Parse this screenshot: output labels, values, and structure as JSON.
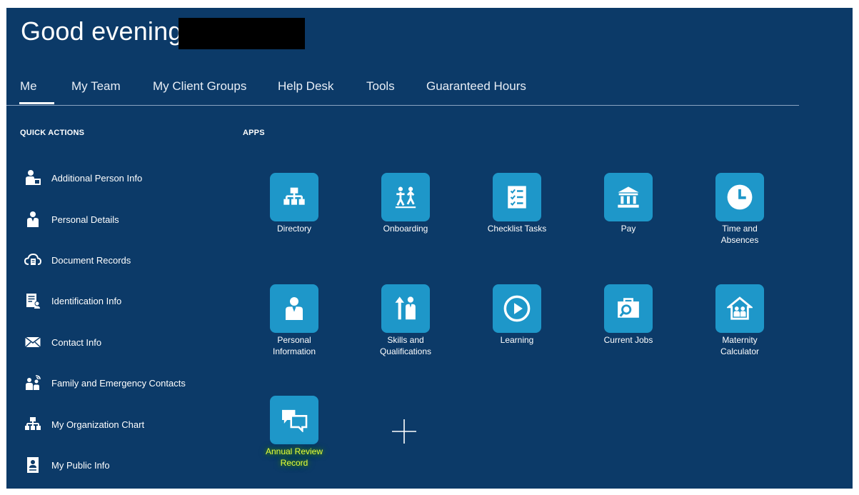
{
  "greeting": "Good evening,",
  "nav": {
    "tabs": [
      {
        "label": "Me"
      },
      {
        "label": "My Team"
      },
      {
        "label": "My Client Groups"
      },
      {
        "label": "Help Desk"
      },
      {
        "label": "Tools"
      },
      {
        "label": "Guaranteed Hours"
      }
    ],
    "active_tab": "Me"
  },
  "quick_actions": {
    "title": "QUICK ACTIONS",
    "items": [
      {
        "label": "Additional Person Info",
        "icon": "person-badge-icon"
      },
      {
        "label": "Personal Details",
        "icon": "person-icon"
      },
      {
        "label": "Document Records",
        "icon": "cloud-document-icon"
      },
      {
        "label": "Identification Info",
        "icon": "id-document-icon"
      },
      {
        "label": "Contact Info",
        "icon": "envelope-icon"
      },
      {
        "label": "Family and Emergency Contacts",
        "icon": "family-icon"
      },
      {
        "label": "My Organization Chart",
        "icon": "org-chart-icon"
      },
      {
        "label": "My Public Info",
        "icon": "badge-icon"
      }
    ]
  },
  "apps": {
    "title": "APPS",
    "tiles": [
      {
        "label": "Directory",
        "icon": "org-chart-icon"
      },
      {
        "label": "Onboarding",
        "icon": "onboarding-people-icon"
      },
      {
        "label": "Checklist Tasks",
        "icon": "checklist-icon"
      },
      {
        "label": "Pay",
        "icon": "bank-icon"
      },
      {
        "label": "Time and\nAbsences",
        "icon": "clock-icon"
      },
      {
        "label": "Personal\nInformation",
        "icon": "person-icon"
      },
      {
        "label": "Skills and\nQualifications",
        "icon": "skills-people-icon"
      },
      {
        "label": "Learning",
        "icon": "play-icon"
      },
      {
        "label": "Current Jobs",
        "icon": "briefcase-search-icon"
      },
      {
        "label": "Maternity\nCalculator",
        "icon": "house-family-icon"
      },
      {
        "label": "Annual Review\nRecord",
        "icon": "chat-bubbles-icon"
      }
    ],
    "add_icon": "plus-icon"
  },
  "colors": {
    "background": "#0c3a68",
    "tile": "#1e97c9",
    "highlight_text": "#e7ff3a"
  }
}
